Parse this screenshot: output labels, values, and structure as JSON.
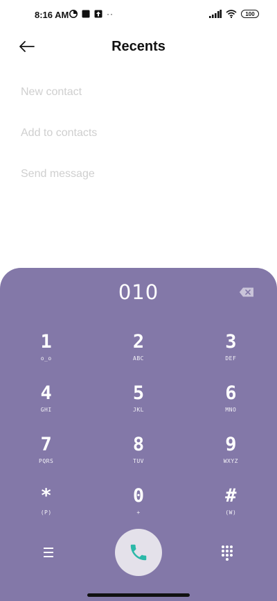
{
  "status_bar": {
    "time": "8:16 AM",
    "battery": "100"
  },
  "header": {
    "title": "Recents",
    "back_icon": "arrow-left-icon"
  },
  "menu": {
    "items": [
      {
        "label": "New contact"
      },
      {
        "label": "Add to contacts"
      },
      {
        "label": "Send message"
      }
    ]
  },
  "dialpad": {
    "number": "010",
    "rows": [
      [
        {
          "digit": "1",
          "sub": "o_o"
        },
        {
          "digit": "2",
          "sub": "ABC"
        },
        {
          "digit": "3",
          "sub": "DEF"
        }
      ],
      [
        {
          "digit": "4",
          "sub": "GHI"
        },
        {
          "digit": "5",
          "sub": "JKL"
        },
        {
          "digit": "6",
          "sub": "MNO"
        }
      ],
      [
        {
          "digit": "7",
          "sub": "PQRS"
        },
        {
          "digit": "8",
          "sub": "TUV"
        },
        {
          "digit": "9",
          "sub": "WXYZ"
        }
      ],
      [
        {
          "digit": "*",
          "sub": "(P)"
        },
        {
          "digit": "0",
          "sub": "+"
        },
        {
          "digit": "#",
          "sub": "(W)"
        }
      ]
    ]
  },
  "colors": {
    "dialpad_bg": "#8378a8",
    "call_icon": "#2bb8a8",
    "call_button_bg": "#e4e1ea"
  }
}
